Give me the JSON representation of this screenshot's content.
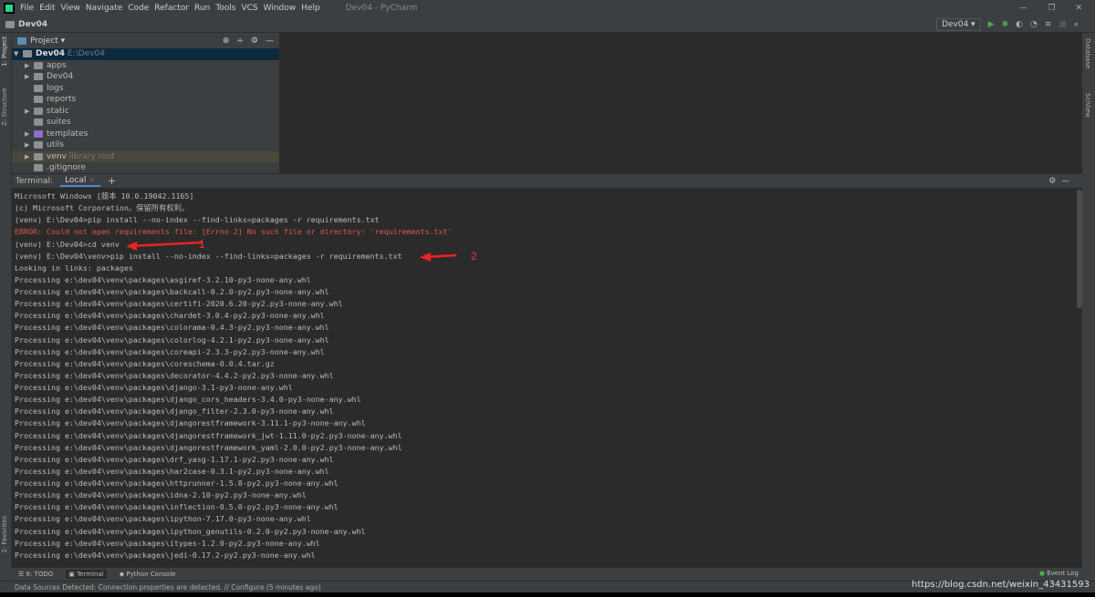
{
  "menu": {
    "items": [
      "File",
      "Edit",
      "View",
      "Navigate",
      "Code",
      "Refactor",
      "Run",
      "Tools",
      "VCS",
      "Window",
      "Help"
    ],
    "title": "Dev04 - PyCharm"
  },
  "nav": {
    "breadcrumb": "Dev04",
    "run_config": "Dev04"
  },
  "side": {
    "project": "1: Project",
    "structure": "Z: Structure",
    "favorites": "2: Favorites",
    "database": "Database",
    "sciview": "SciView"
  },
  "project": {
    "title": "Project",
    "root": {
      "name": "Dev04",
      "path": "E:\\Dev04"
    },
    "items": [
      {
        "name": "apps",
        "expandable": true
      },
      {
        "name": "Dev04",
        "expandable": true
      },
      {
        "name": "logs",
        "expandable": false
      },
      {
        "name": "reports",
        "expandable": false
      },
      {
        "name": "static",
        "expandable": true
      },
      {
        "name": "suites",
        "expandable": false
      },
      {
        "name": "templates",
        "expandable": true,
        "color": "#8e6fc2"
      },
      {
        "name": "utils",
        "expandable": true
      },
      {
        "name": "venv",
        "expandable": true,
        "hint": "library root"
      },
      {
        "name": ".gitignore",
        "expandable": false,
        "file": true
      }
    ]
  },
  "terminal": {
    "label": "Terminal:",
    "tab": "Local",
    "add": "+",
    "lines": [
      {
        "t": "Microsoft Windows [版本 10.0.19042.1165]"
      },
      {
        "t": "(c) Microsoft Corporation。保留所有权利。"
      },
      {
        "t": "(venv) E:\\Dev04>pip install --no-index --find-links=packages -r requirements.txt"
      },
      {
        "t": "ERROR: Could not open requirements file: [Errno 2] No such file or directory: 'requirements.txt'",
        "error": true
      },
      {
        "t": "(venv) E:\\Dev04>cd venv"
      },
      {
        "t": "(venv) E:\\Dev04\\venv>pip install --no-index --find-links=packages -r requirements.txt"
      },
      {
        "t": "Looking in links: packages"
      },
      {
        "t": "Processing e:\\dev04\\venv\\packages\\asgiref-3.2.10-py3-none-any.whl"
      },
      {
        "t": "Processing e:\\dev04\\venv\\packages\\backcall-0.2.0-py2.py3-none-any.whl"
      },
      {
        "t": "Processing e:\\dev04\\venv\\packages\\certifi-2020.6.20-py2.py3-none-any.whl"
      },
      {
        "t": "Processing e:\\dev04\\venv\\packages\\chardet-3.0.4-py2.py3-none-any.whl"
      },
      {
        "t": "Processing e:\\dev04\\venv\\packages\\colorama-0.4.3-py2.py3-none-any.whl"
      },
      {
        "t": "Processing e:\\dev04\\venv\\packages\\colorlog-4.2.1-py2.py3-none-any.whl"
      },
      {
        "t": "Processing e:\\dev04\\venv\\packages\\coreapi-2.3.3-py2.py3-none-any.whl"
      },
      {
        "t": "Processing e:\\dev04\\venv\\packages\\coreschema-0.0.4.tar.gz"
      },
      {
        "t": "Processing e:\\dev04\\venv\\packages\\decorator-4.4.2-py2.py3-none-any.whl"
      },
      {
        "t": "Processing e:\\dev04\\venv\\packages\\django-3.1-py3-none-any.whl"
      },
      {
        "t": "Processing e:\\dev04\\venv\\packages\\django_cors_headers-3.4.0-py3-none-any.whl"
      },
      {
        "t": "Processing e:\\dev04\\venv\\packages\\django_filter-2.3.0-py3-none-any.whl"
      },
      {
        "t": "Processing e:\\dev04\\venv\\packages\\djangorestframework-3.11.1-py3-none-any.whl"
      },
      {
        "t": "Processing e:\\dev04\\venv\\packages\\djangorestframework_jwt-1.11.0-py2.py3-none-any.whl"
      },
      {
        "t": "Processing e:\\dev04\\venv\\packages\\djangorestframework_yaml-2.0.0-py2.py3-none-any.whl"
      },
      {
        "t": "Processing e:\\dev04\\venv\\packages\\drf_yasg-1.17.1-py2.py3-none-any.whl"
      },
      {
        "t": "Processing e:\\dev04\\venv\\packages\\har2case-0.3.1-py2.py3-none-any.whl"
      },
      {
        "t": "Processing e:\\dev04\\venv\\packages\\httprunner-1.5.8-py2.py3-none-any.whl"
      },
      {
        "t": "Processing e:\\dev04\\venv\\packages\\idna-2.10-py2.py3-none-any.whl"
      },
      {
        "t": "Processing e:\\dev04\\venv\\packages\\inflection-0.5.0-py2.py3-none-any.whl"
      },
      {
        "t": "Processing e:\\dev04\\venv\\packages\\ipython-7.17.0-py3-none-any.whl"
      },
      {
        "t": "Processing e:\\dev04\\venv\\packages\\ipython_genutils-0.2.0-py2.py3-none-any.whl"
      },
      {
        "t": "Processing e:\\dev04\\venv\\packages\\itypes-1.2.0-py2.py3-none-any.whl"
      },
      {
        "t": "Processing e:\\dev04\\venv\\packages\\jedi-0.17.2-py2.py3-none-any.whl"
      }
    ],
    "annotations": [
      "1",
      "2"
    ]
  },
  "bottom": {
    "todo": "6: TODO",
    "terminal": "Terminal",
    "python_console": "Python Console",
    "event_log": "Event Log"
  },
  "status": {
    "message": "Data Sources Detected: Connection properties are detected. // Configure (5 minutes ago)",
    "watermark": "https://blog.csdn.net/weixin_43431593"
  },
  "colors": {
    "error": "#e0554e",
    "annotation": "#ee2222",
    "selection": "#0d293e"
  }
}
